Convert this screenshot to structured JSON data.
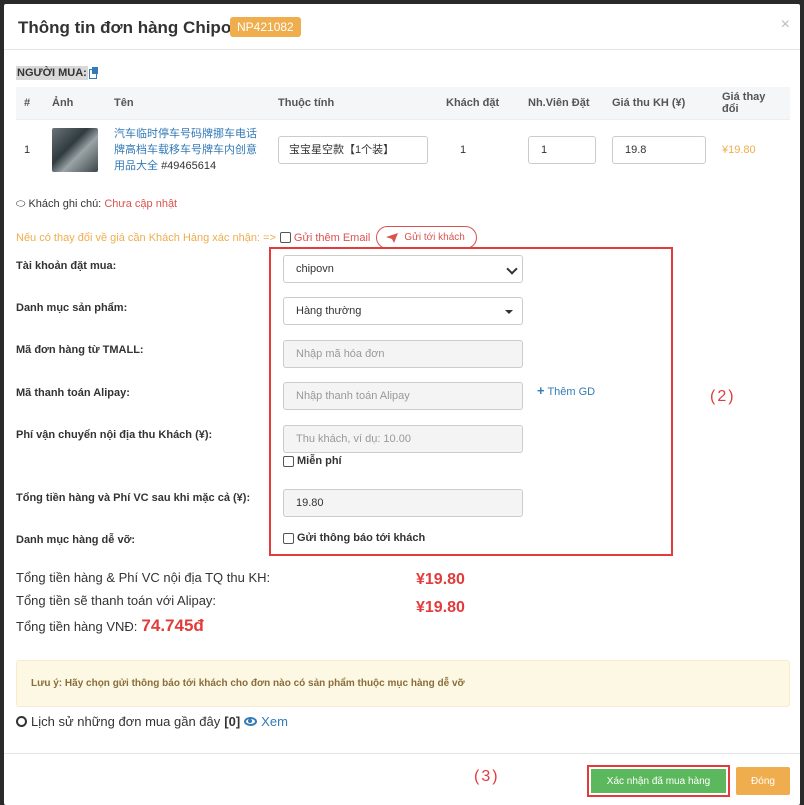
{
  "header": {
    "title": "Thông tin đơn hàng Chipo:",
    "order_code": "NP421082",
    "close": "×"
  },
  "buyer_label": "NGƯỜI MUA:",
  "table": {
    "headers": [
      "#",
      "Ảnh",
      "Tên",
      "Thuộc tính",
      "Khách đặt",
      "Nh.Viên Đặt",
      "Giá thu KH (¥)",
      "Giá thay đổi"
    ],
    "row": {
      "index": "1",
      "name": "汽车临时停车号码牌挪车电话牌高档车载移车号牌车内创意用品大全",
      "id": "#49465614",
      "attribute": "宝宝星空款【1个装】",
      "customer_qty": "1",
      "staff_qty": "1",
      "price": "19.8",
      "price_change": "¥19.80"
    }
  },
  "note": {
    "label": "Khách ghi chú:",
    "value": "Chưa cập nhật"
  },
  "confirm": {
    "text": "Nếu có thay đổi về giá cần Khách Hàng xác nhận: =>",
    "email_label": "Gửi thêm Email",
    "send_button": "Gửi tới khách"
  },
  "form": {
    "account_label": "Tài khoản đặt mua:",
    "account_value": "chipovn",
    "category_label": "Danh mục sản phẩm:",
    "category_value": "Hàng thường",
    "tmall_label": "Mã đơn hàng từ TMALL:",
    "tmall_placeholder": "Nhập mã hóa đơn",
    "alipay_label": "Mã thanh toán Alipay:",
    "alipay_placeholder": "Nhập thanh toán Alipay",
    "add_gd": "Thêm GD",
    "shipping_label": "Phí vận chuyển nội địa thu Khách (¥):",
    "shipping_placeholder": "Thu khách, ví dụ: 10.00",
    "free_label": "Miễn phí",
    "total_after_label": "Tổng tiền hàng và Phí VC sau khi mặc cả (¥):",
    "total_after_value": "19.80",
    "fragile_label": "Danh mục hàng dễ vỡ:",
    "notify_label": "Gửi thông báo tới khách"
  },
  "annotations": {
    "frame_2": "(2)",
    "frame_3": "(3)"
  },
  "summary": {
    "line1_label": "Tổng tiền hàng & Phí VC nội địa TQ thu KH:",
    "line1_value": "¥19.80",
    "line2_label": "Tổng tiền sẽ thanh toán với Alipay:",
    "line2_value": "¥19.80",
    "line3_label": "Tổng tiền hàng VNĐ:",
    "line3_value": "74.745đ"
  },
  "alert": "Lưu ý: Hãy chọn gửi thông báo tới khách cho đơn nào có sản phẩm thuộc mục hàng dễ vỡ",
  "history": {
    "label": "Lịch sử những đơn mua gần đây",
    "count": "[0]",
    "view": "Xem"
  },
  "footer": {
    "confirm_button": "Xác nhận đã mua hàng",
    "close_button": "Đóng"
  },
  "colors": {
    "accent_orange": "#f0ad4e",
    "success_green": "#5cb85c",
    "danger_red": "#e23b3b",
    "link_blue": "#337ab7"
  }
}
